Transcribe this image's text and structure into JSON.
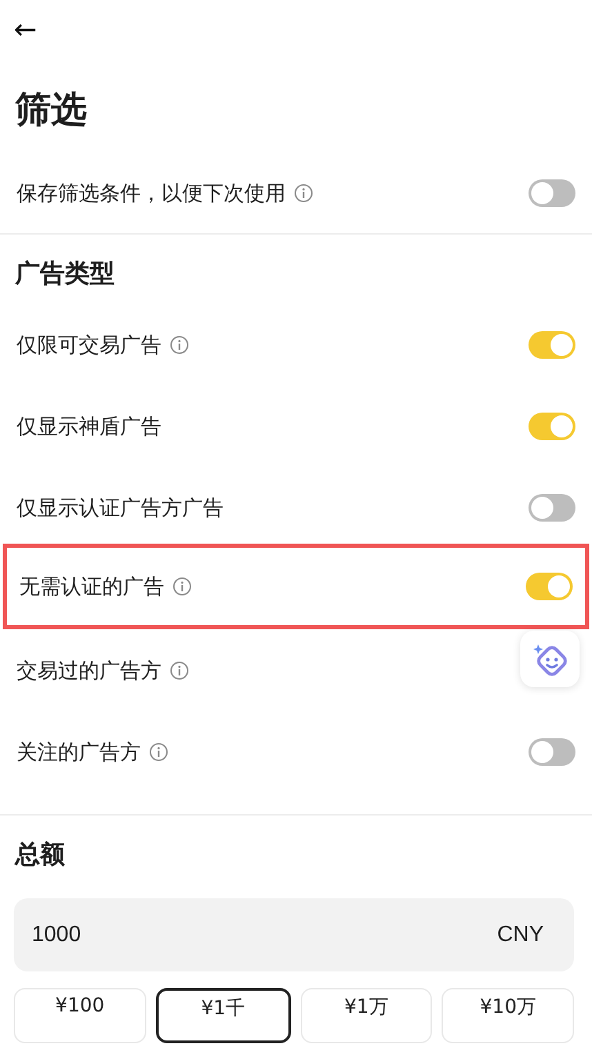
{
  "header": {
    "back": "←",
    "title": "筛选"
  },
  "save_option": {
    "label": "保存筛选条件，以便下次使用",
    "info": true,
    "on": false
  },
  "ad_type": {
    "heading": "广告类型",
    "rows": [
      {
        "label": "仅限可交易广告",
        "info": true,
        "on": true,
        "highlighted": false
      },
      {
        "label": "仅显示神盾广告",
        "on": true,
        "highlighted": false
      },
      {
        "label": "仅显示认证广告方广告",
        "on": false,
        "highlighted": false
      },
      {
        "label": "无需认证的广告",
        "info": true,
        "on": true,
        "highlighted": true
      },
      {
        "label": "交易过的广告方",
        "info": true,
        "highlighted": false,
        "assistant": true
      },
      {
        "label": "关注的广告方",
        "info": true,
        "on": false,
        "highlighted": false
      }
    ]
  },
  "amount": {
    "heading": "总额",
    "value": "1000",
    "currency": "CNY",
    "presets": [
      {
        "label": "¥100",
        "selected": false
      },
      {
        "label": "¥1千",
        "selected": true
      },
      {
        "label": "¥1万",
        "selected": false
      },
      {
        "label": "¥10万",
        "selected": false
      }
    ]
  }
}
